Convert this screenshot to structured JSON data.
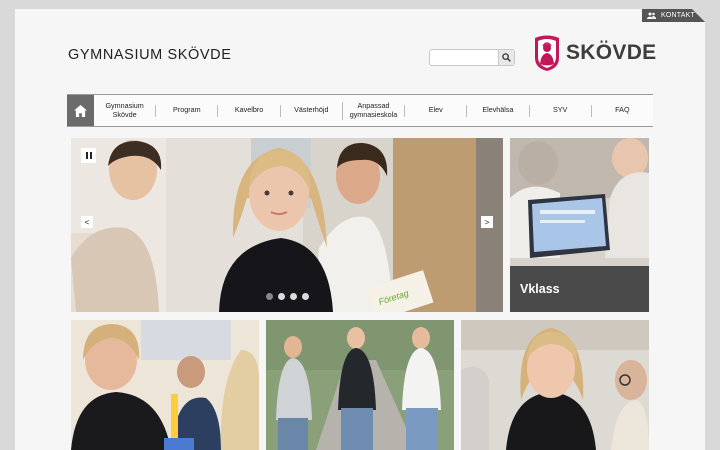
{
  "header": {
    "contact_label": "KONTAKT",
    "site_title": "GYMNASIUM SKÖVDE",
    "logo_text": "SKÖVDE",
    "search": {
      "placeholder": "",
      "value": ""
    }
  },
  "nav": {
    "items": [
      {
        "label": "Gymnasium Skövde"
      },
      {
        "label": "Program"
      },
      {
        "label": "Kavelbro"
      },
      {
        "label": "Västerhöjd"
      },
      {
        "label": "Anpassad gymnasieskola"
      },
      {
        "label": "Elev"
      },
      {
        "label": "Elevhälsa"
      },
      {
        "label": "SYV"
      },
      {
        "label": "FAQ"
      }
    ]
  },
  "hero": {
    "prev_label": "<",
    "next_label": ">",
    "slide_count": 4,
    "active_slide": 1
  },
  "side_card": {
    "label": "Vklass"
  },
  "colors": {
    "brand": "#c2185b",
    "nav_home": "#6b6b6b",
    "card_label_bg": "#4a4a4a"
  }
}
